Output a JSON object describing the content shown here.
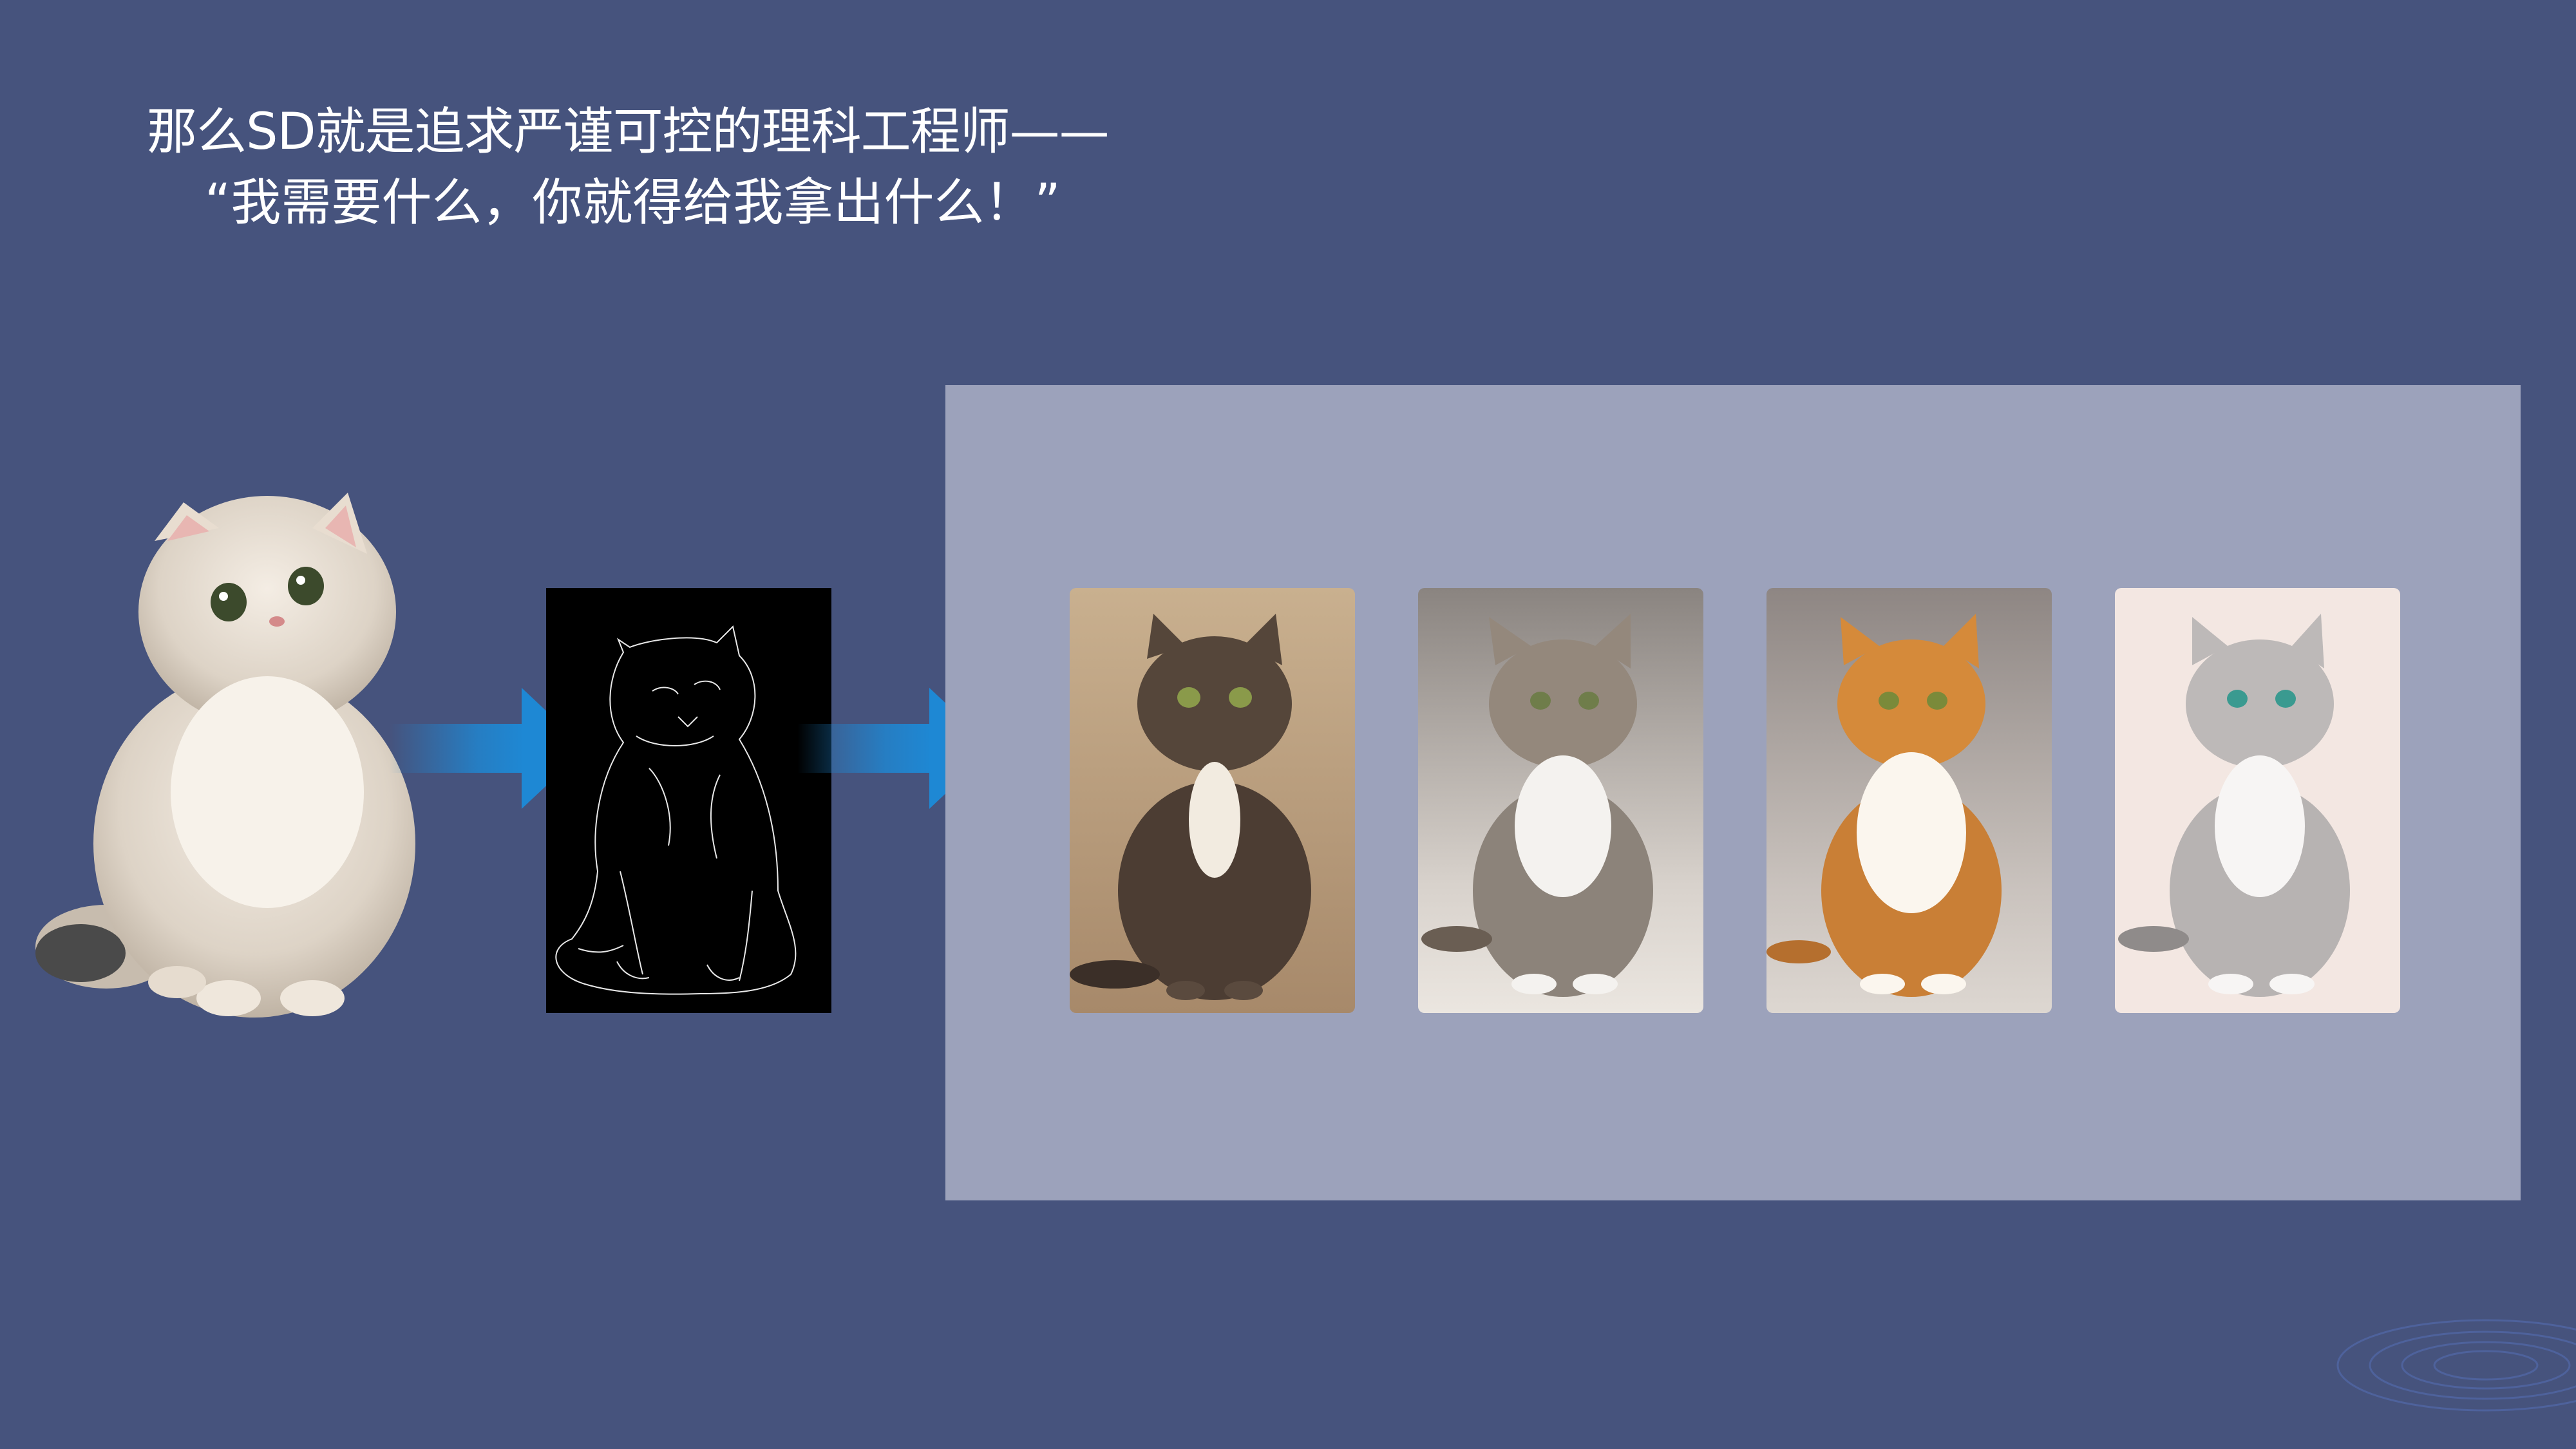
{
  "slide": {
    "title_line1": "那么SD就是追求严谨可控的理科工程师——",
    "title_line2": "“我需要什么，你就得给我拿出什么！”"
  },
  "colors": {
    "background": "#46537d",
    "panel": "#9ca2bb",
    "arrow": "#1e88d4",
    "edge_bg": "#000000"
  },
  "images": [
    {
      "name": "source-cat-photo"
    },
    {
      "name": "edge-map-image"
    },
    {
      "name": "result-tabby-brown"
    },
    {
      "name": "result-tabby-white"
    },
    {
      "name": "result-orange-tabby"
    },
    {
      "name": "result-gray-tabby"
    }
  ]
}
